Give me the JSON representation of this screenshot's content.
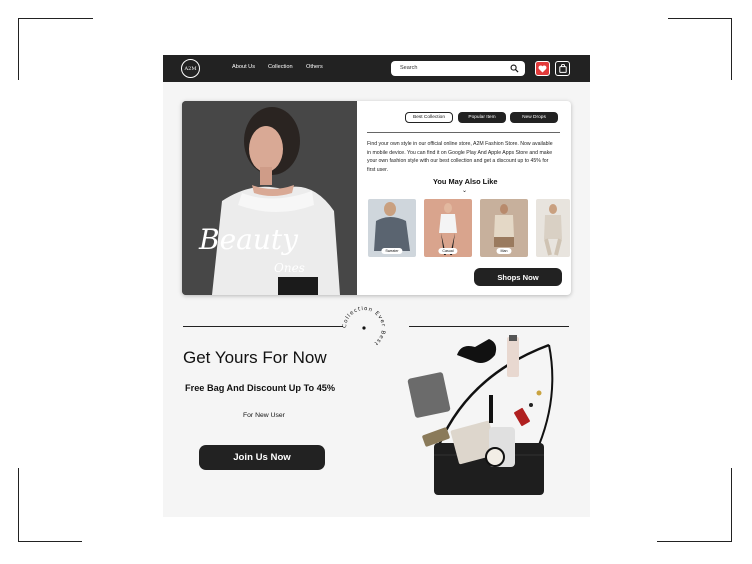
{
  "nav": {
    "logo": "A2M",
    "links": [
      "About Us",
      "Collection",
      "Others"
    ],
    "search_placeholder": "Search"
  },
  "hero": {
    "script_title": "Beauty",
    "script_subtitle": "Ones",
    "tabs": [
      "Best Collection",
      "Popular Item",
      "New Drops"
    ],
    "description": "Find your own style in our official online store, A2M Fashion Store. Now available in mobile device. You can find it on Google Play And Apple Apps Store and make your own fashion style with our best collection and get a discount up to 45% for first user.",
    "also_like_title": "You May Also Like",
    "products": [
      "Sweater",
      "Casual",
      "Man"
    ],
    "shop_button": "Shops Now"
  },
  "badge": {
    "text": "Collection  Ever  Best"
  },
  "promo": {
    "headline": "Get Yours For Now",
    "subheadline": "Free Bag And Discount Up To 45%",
    "note": "For New User",
    "join_button": "Join Us Now"
  },
  "colors": {
    "dark": "#222222",
    "accent_heart": "#e23b3b",
    "page_bg": "#f5f5f5"
  }
}
